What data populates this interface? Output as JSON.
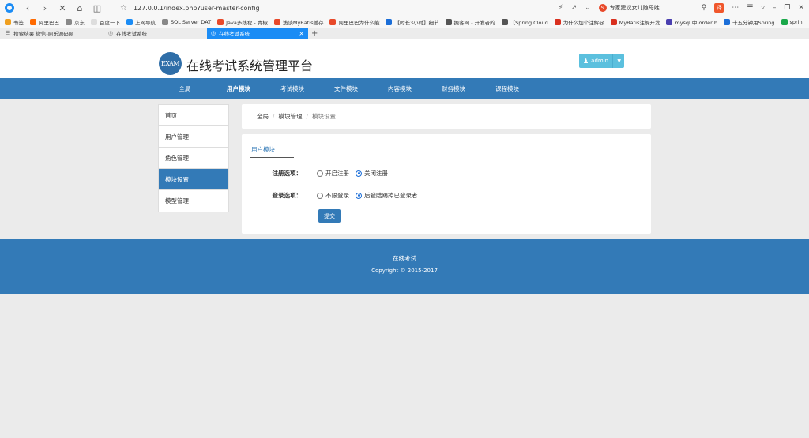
{
  "browser": {
    "url": "127.0.0.1/index.php?user-master-config",
    "search_text": "专家建议女儿随母姓",
    "translate_badge": "译",
    "bookmarks": [
      {
        "label": "书签",
        "color": "#f0a020"
      },
      {
        "label": "阿里巴巴",
        "color": "#ff6a00"
      },
      {
        "label": "京东",
        "color": "#888888"
      },
      {
        "label": "百度一下",
        "color": "#dddddd"
      },
      {
        "label": "上网导航",
        "color": "#1b8cf5"
      },
      {
        "label": "SQL Server DAT",
        "color": "#888888"
      },
      {
        "label": "Java多线程 - 青椒",
        "color": "#e8492a"
      },
      {
        "label": "浅谈MyBatis缓存",
        "color": "#e8492a"
      },
      {
        "label": "阿里巴巴为什么能",
        "color": "#e8492a"
      },
      {
        "label": "【时长3小时】细节",
        "color": "#1b6ed8"
      },
      {
        "label": "掘客网 - 开发者的",
        "color": "#555555"
      },
      {
        "label": "【Spring Cloud",
        "color": "#555555"
      },
      {
        "label": "为什么加个注解@",
        "color": "#d9301f"
      },
      {
        "label": "MyBatis注解开发",
        "color": "#d9301f"
      },
      {
        "label": "mysql 中 order b",
        "color": "#4a3fb0"
      },
      {
        "label": "十五分钟用Spring",
        "color": "#1b6ed8"
      },
      {
        "label": "sprin",
        "color": "#1aa84a"
      }
    ],
    "bookmarks_more": "»",
    "tabs": [
      {
        "label": "搜索结果 微信-阿乐源码网",
        "active": false
      },
      {
        "label": "在线考试系统",
        "active": false
      },
      {
        "label": "在线考试系统",
        "active": true
      }
    ],
    "new_tab": "+"
  },
  "header": {
    "logo_text": "EXAM",
    "title": "在线考试系统管理平台",
    "user_label": "admin"
  },
  "nav": {
    "items": [
      "全局",
      "用户模块",
      "考试模块",
      "文件模块",
      "内容模块",
      "财务模块",
      "课程模块"
    ],
    "active_index": 1
  },
  "sidebar": {
    "items": [
      "首页",
      "用户管理",
      "角色管理",
      "模块设置",
      "模型管理"
    ],
    "active_index": 3
  },
  "breadcrumb": {
    "items": [
      "全局",
      "模块管理",
      "模块设置"
    ]
  },
  "form": {
    "section_title": "用户模块",
    "register": {
      "label": "注册选项：",
      "options": [
        "开启注册",
        "关闭注册"
      ],
      "selected": 1
    },
    "login": {
      "label": "登录选项：",
      "options": [
        "不限登录",
        "后登陆踢掉已登录者"
      ],
      "selected": 1
    },
    "submit_label": "提交"
  },
  "footer": {
    "line1": "在线考试",
    "line2": "Copyright © 2015-2017"
  }
}
